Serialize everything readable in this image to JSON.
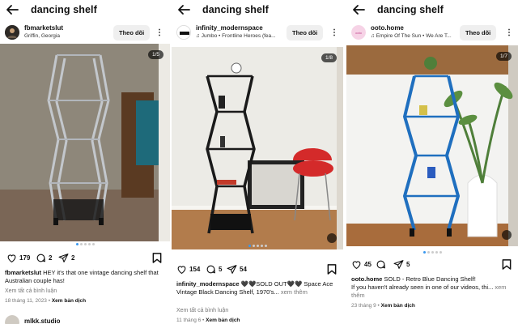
{
  "search_title": "dancing shelf",
  "follow_label": "Theo dõi",
  "see_translation": "Xem bản dịch",
  "posts": [
    {
      "username": "fbmarketslut",
      "subtitle": "Griffin, Georgia",
      "counter": "1/5",
      "likes": "179",
      "comments": "2",
      "shares": "2",
      "caption_user": "fbmarketslut",
      "caption_text": "HEY it's that one vintage dancing shelf that Australian couple has!",
      "view_comments": "Xem tất cả bình luận",
      "date": "18 tháng 11, 2023",
      "colors": {
        "frame": "#b8bcc2",
        "wall": "#8a8070",
        "floor": "#7a6a5c"
      }
    },
    {
      "username": "infinity_modernspace",
      "subtitle": "Jumbo • Frontline Heroes (fea...",
      "counter": "1/8",
      "likes": "154",
      "comments": "5",
      "shares": "54",
      "caption_user": "infinity_modernspace",
      "caption_text": "🖤🖤SOLD OUT🖤🖤 Space Ace Vintage Black Dancing Shelf, 1970's...",
      "caption_more": "xem thêm",
      "view_comments": "Xem tất cả bình luận",
      "date": "11 tháng 6",
      "colors": {
        "frame": "#1a1a1a",
        "wall": "#ecebe6",
        "floor": "#b07a4a",
        "chair": "#d42a2a"
      }
    },
    {
      "username": "ooto.home",
      "subtitle": "Empire Of The Sun • We Are T...",
      "counter": "1/7",
      "likes": "45",
      "comments": "",
      "shares": "5",
      "caption_user": "ooto.home",
      "caption_text": "SOLD - Retro Blue Dancing Shelf!",
      "caption_line2": "If you haven't already seen in one of our videos, thi...",
      "caption_more": "xem thêm",
      "date": "23 tháng 9",
      "colors": {
        "frame": "#1f6fbf",
        "wall": "#f3f3f1",
        "floor": "#a86c3c",
        "plant": "#4f7f3a"
      }
    }
  ],
  "next_post": {
    "username": "mlkk.studio"
  }
}
